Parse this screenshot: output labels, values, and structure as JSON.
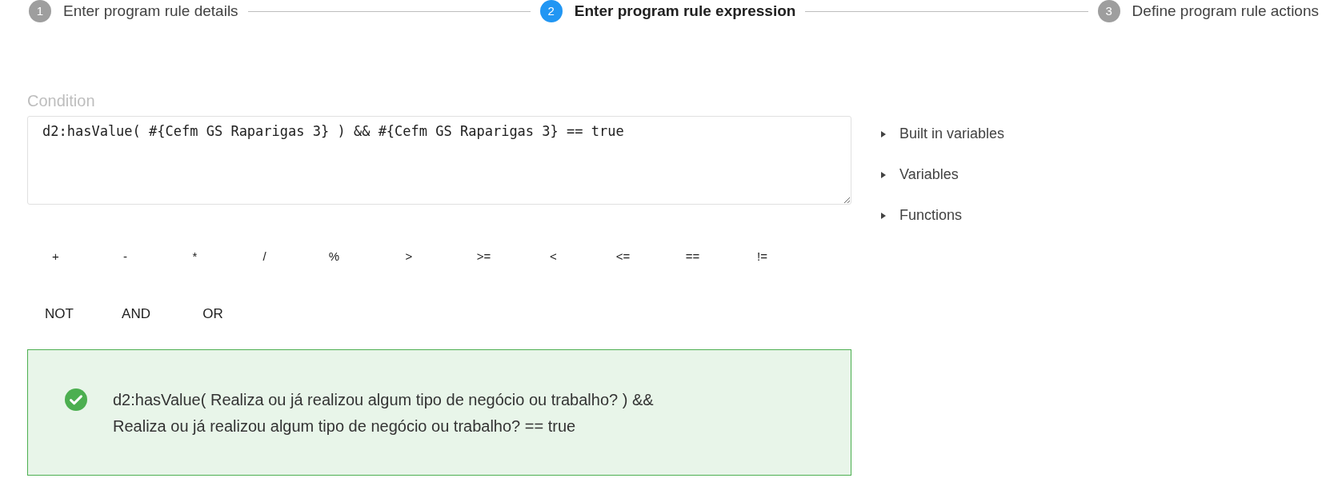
{
  "steps": [
    {
      "number": "1",
      "label": "Enter program rule details",
      "selected": false
    },
    {
      "number": "2",
      "label": "Enter program rule expression",
      "selected": true
    },
    {
      "number": "3",
      "label": "Define program rule actions",
      "selected": false
    }
  ],
  "condition": {
    "label": "Condition",
    "value": "d2:hasValue( #{Cefm GS Raparigas 3} ) && #{Cefm GS Raparigas 3} == true"
  },
  "side_sections": [
    {
      "label": "Built in variables",
      "expanded": false
    },
    {
      "label": "Variables",
      "expanded": false
    },
    {
      "label": "Functions",
      "expanded": false
    }
  ],
  "operators": [
    "+",
    "-",
    "*",
    "/",
    "%",
    ">",
    ">=",
    "<",
    "<=",
    "==",
    "!="
  ],
  "logic_operators": [
    "NOT",
    "AND",
    "OR"
  ],
  "validation": {
    "valid": true,
    "lines": [
      "d2:hasValue( Realiza ou já realizou algum tipo de negócio ou trabalho? ) &&",
      "Realiza ou já realizou algum tipo de negócio ou trabalho? == true"
    ]
  }
}
